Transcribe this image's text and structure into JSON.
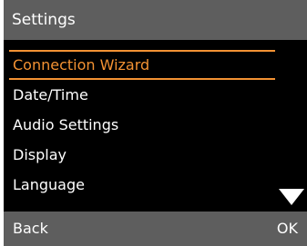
{
  "header": {
    "title": "Settings"
  },
  "menu": {
    "items": [
      {
        "label": "Connection Wizard"
      },
      {
        "label": "Date/Time"
      },
      {
        "label": "Audio Settings"
      },
      {
        "label": "Display"
      },
      {
        "label": "Language"
      }
    ],
    "selected_index": 0,
    "scroll_indicator_icon": "triangle-down"
  },
  "softkeys": {
    "left_label": "Back",
    "right_label": "OK"
  },
  "colors": {
    "bars": "#5e5e5e",
    "background": "#000000",
    "text": "#ffffff",
    "highlight": "#f39233"
  }
}
